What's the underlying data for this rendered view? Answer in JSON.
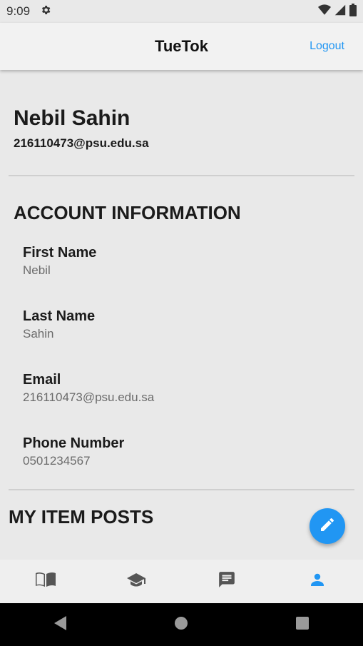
{
  "status": {
    "time": "9:09"
  },
  "appbar": {
    "title": "TueTok",
    "logout_label": "Logout"
  },
  "profile": {
    "name": "Nebil Sahin",
    "email": "216110473@psu.edu.sa"
  },
  "account": {
    "title": "ACCOUNT INFORMATION",
    "fields": [
      {
        "label": "First Name",
        "value": "Nebil"
      },
      {
        "label": "Last Name",
        "value": "Sahin"
      },
      {
        "label": "Email",
        "value": "216110473@psu.edu.sa"
      },
      {
        "label": "Phone Number",
        "value": "0501234567"
      }
    ]
  },
  "posts": {
    "title": "MY ITEM POSTS"
  },
  "colors": {
    "accent": "#2196f3",
    "inactive_icon": "#555555"
  },
  "icons": {
    "fab": "pencil-icon",
    "nav": [
      "book-icon",
      "graduation-cap-icon",
      "message-icon",
      "person-icon"
    ],
    "system": [
      "back-icon",
      "home-icon",
      "recents-icon"
    ]
  }
}
